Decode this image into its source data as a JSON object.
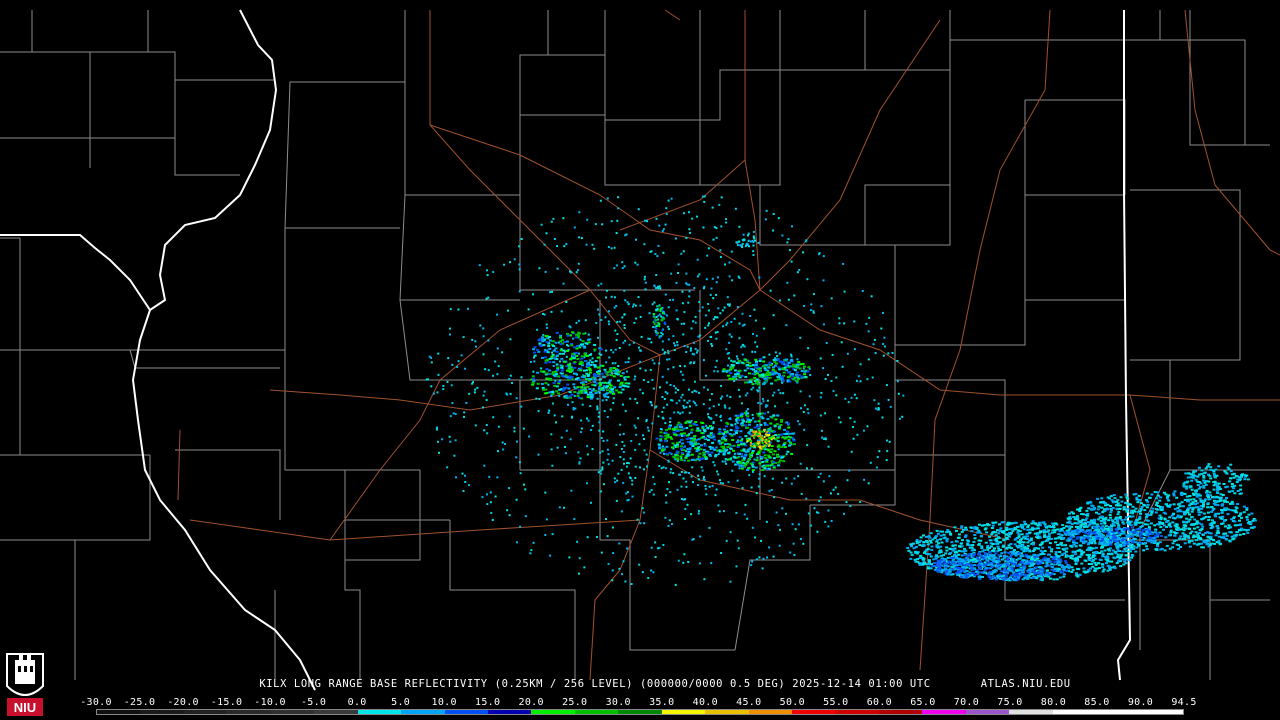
{
  "product": {
    "caption": "KILX LONG RANGE BASE REFLECTIVITY (0.25KM / 256 LEVEL) (000000/0000 0.5 DEG) 2025-12-14 01:00 UTC",
    "site_url": "ATLAS.NIU.EDU",
    "logo_text": "NIU"
  },
  "colors": {
    "background": "#000000",
    "county_lines": "#8c8c8c",
    "state_lines": "#ffffff",
    "roads": "#a0522d"
  },
  "scale": {
    "labels": [
      "-30.0",
      "-25.0",
      "-20.0",
      "-15.0",
      "-10.0",
      "-5.0",
      "0.0",
      "5.0",
      "10.0",
      "15.0",
      "20.0",
      "25.0",
      "30.0",
      "35.0",
      "40.0",
      "45.0",
      "50.0",
      "55.0",
      "60.0",
      "65.0",
      "70.0",
      "75.0",
      "80.0",
      "85.0",
      "90.0",
      "94.5"
    ],
    "colors": [
      "#101010",
      "#1a1a1a",
      "#222222",
      "#2a2a2a",
      "#303030",
      "#3a3a3a",
      "#00e5e5",
      "#00a5f5",
      "#0050f0",
      "#0000b0",
      "#00f000",
      "#00c000",
      "#008800",
      "#f5f500",
      "#e8c000",
      "#f09000",
      "#f00000",
      "#d00000",
      "#b00000",
      "#f000f0",
      "#9955c9",
      "#e0e0e0",
      "#ffffff",
      "#ffffff",
      "#ffffff"
    ]
  }
}
